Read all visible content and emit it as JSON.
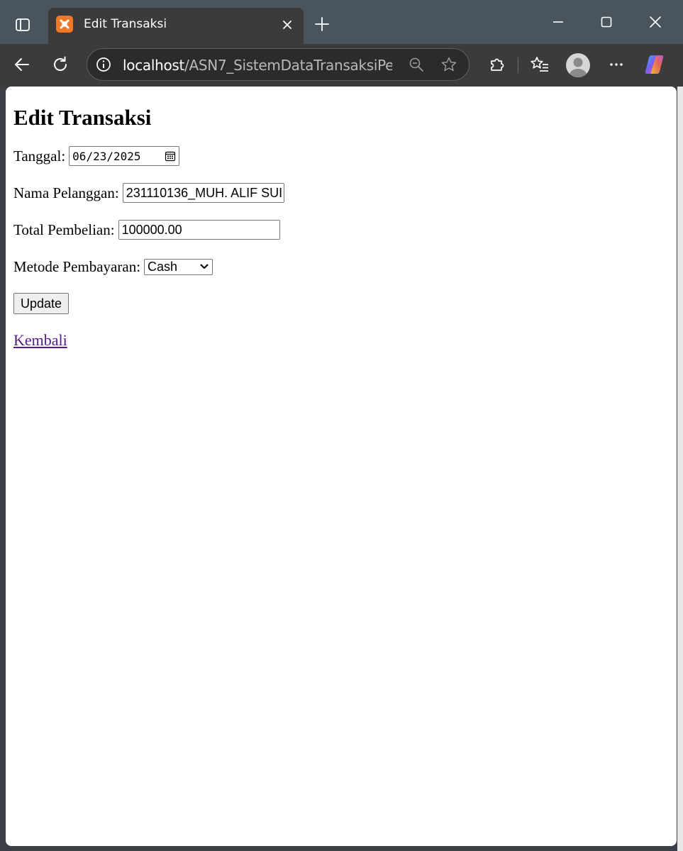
{
  "browser": {
    "tab_title": "Edit Transaksi",
    "url_host": "localhost",
    "url_path": "/ASN7_SistemDataTransaksiPe..."
  },
  "page": {
    "heading": "Edit Transaksi",
    "form": {
      "tanggal_label": "Tanggal:",
      "tanggal_value": "06/23/2025",
      "nama_label": "Nama Pelanggan:",
      "nama_value": "231110136_MUH. ALIF SUI",
      "total_label": "Total Pembelian:",
      "total_value": "100000.00",
      "metode_label": "Metode Pembayaran:",
      "metode_value": "Cash",
      "update_label": "Update"
    },
    "back_link": "Kembali"
  },
  "colors": {
    "chrome_bg": "#4a545c",
    "tab_bg": "#3b3b3b",
    "favicon": "#f17828",
    "visited_link": "#551a8b"
  }
}
